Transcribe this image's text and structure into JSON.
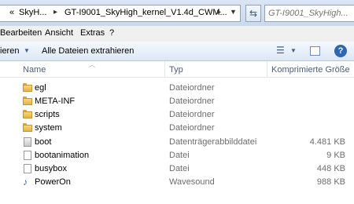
{
  "address_bar": {
    "overflow_chevron": "«",
    "segments": [
      "SkyH...",
      "GT-I9001_SkyHigh_kernel_V1.4d_CWM..."
    ],
    "search_placeholder": "GT-I9001_SkyHigh..."
  },
  "menu": [
    "Bearbeiten",
    "Ansicht",
    "Extras",
    "?"
  ],
  "command_bar": {
    "organize_label": "ieren",
    "extract_label": "Alle Dateien extrahieren"
  },
  "columns": {
    "name": "Name",
    "type": "Typ",
    "size": "Komprimierte Größe"
  },
  "files": [
    {
      "name": "egl",
      "type": "Dateiordner",
      "size": "",
      "icon": "folder-icon"
    },
    {
      "name": "META-INF",
      "type": "Dateiordner",
      "size": "",
      "icon": "folder-icon"
    },
    {
      "name": "scripts",
      "type": "Dateiordner",
      "size": "",
      "icon": "folder-icon"
    },
    {
      "name": "system",
      "type": "Dateiordner",
      "size": "",
      "icon": "folder-icon"
    },
    {
      "name": "boot",
      "type": "Datenträgerabbilddatei",
      "size": "4.481 KB",
      "icon": "disk-image-icon"
    },
    {
      "name": "bootanimation",
      "type": "Datei",
      "size": "9 KB",
      "icon": "file-icon"
    },
    {
      "name": "busybox",
      "type": "Datei",
      "size": "448 KB",
      "icon": "file-icon"
    },
    {
      "name": "PowerOn",
      "type": "Wavesound",
      "size": "988 KB",
      "icon": "sound-file-icon"
    }
  ],
  "colors": {
    "accent": "#2f66b3",
    "folder": "#f0c75e"
  }
}
